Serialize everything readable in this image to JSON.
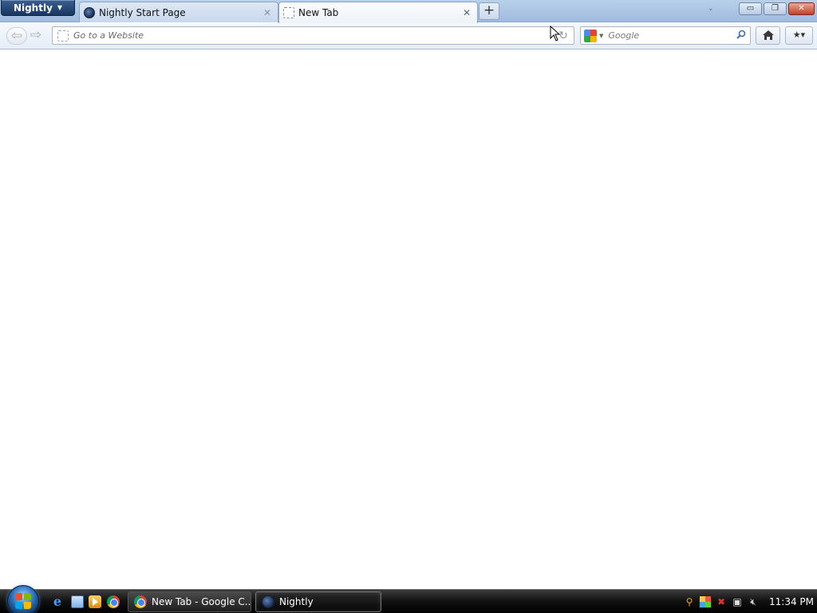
{
  "browser": {
    "app_button_label": "Nightly",
    "tabs": [
      {
        "label": "Nightly Start Page",
        "icon": "nightly-icon",
        "selected": false
      },
      {
        "label": "New Tab",
        "icon": "blank-page-icon",
        "selected": true
      }
    ],
    "new_tab_label": "+",
    "window_controls": {
      "minimize": "▭",
      "restore": "❐",
      "close": "✕"
    },
    "toolbar": {
      "back_icon": "back-arrow-icon",
      "forward_icon": "forward-arrow-icon",
      "url_placeholder": "Go to a Website",
      "url_value": "",
      "search_engine": "google-icon",
      "search_placeholder": "Google",
      "home_icon": "home-icon",
      "bookmarks_icon": "bookmarks-icon"
    }
  },
  "taskbar": {
    "quick_launch": [
      "internet-explorer-icon",
      "show-desktop-icon",
      "media-player-icon",
      "chrome-icon"
    ],
    "windows": [
      {
        "label": "New Tab - Google C...",
        "icon": "chrome-icon",
        "active": false
      },
      {
        "label": "Nightly",
        "icon": "nightly-icon",
        "active": true
      }
    ],
    "tray_icons": [
      "search-icon",
      "windows-flag-icon",
      "security-alert-icon",
      "network-icon",
      "volume-muted-icon"
    ],
    "clock": "11:34 PM"
  },
  "colors": {
    "titlebar": "#b9d1ea",
    "app_button": "#18365f",
    "close_button": "#c5402a",
    "taskbar": "#101010"
  }
}
